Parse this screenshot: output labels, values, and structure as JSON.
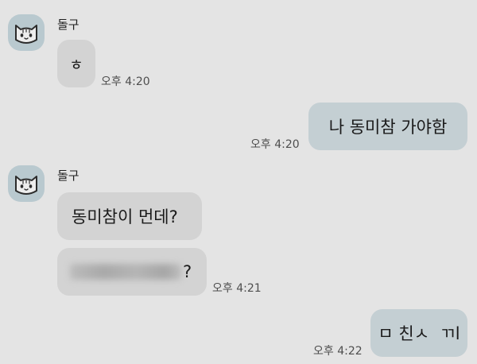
{
  "colors": {
    "background": "#e4e4e4",
    "incoming_bubble": "#d3d3d3",
    "outgoing_bubble": "#c4cfd3",
    "avatar_bg": "#b9c9cf"
  },
  "messages": [
    {
      "direction": "incoming",
      "sender": "돌구",
      "avatar_icon": "cat-face-icon",
      "text": "ㅎ",
      "time": "오후 4:20"
    },
    {
      "direction": "outgoing",
      "text": "나 동미참 가야함",
      "time": "오후 4:20"
    },
    {
      "direction": "incoming",
      "sender": "돌구",
      "avatar_icon": "cat-face-icon",
      "text": "동미참이 먼데?"
    },
    {
      "direction": "incoming",
      "redacted": true,
      "text": "?",
      "time": "오후 4:21"
    },
    {
      "direction": "outgoing",
      "text": "ㅁ 친ㅅ  ㄲl",
      "time": "오후 4:22"
    }
  ]
}
